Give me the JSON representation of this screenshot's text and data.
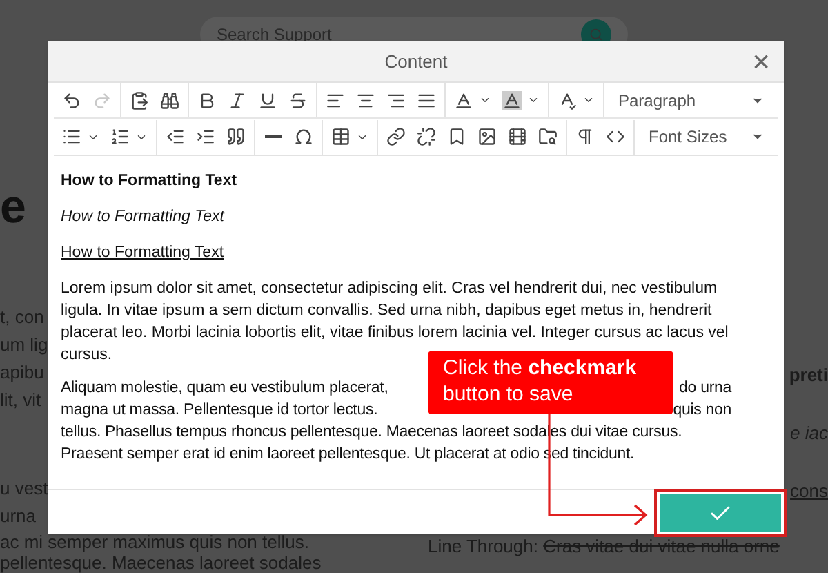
{
  "background": {
    "search": {
      "placeholder": "Search Support"
    },
    "left_fragments": [
      "e",
      "t, con",
      "um lig",
      "apibu",
      "lit, vit",
      "u vest",
      "urna"
    ],
    "right_fragments": [
      "preti",
      "e iac",
      "cons"
    ],
    "bottom_left": [
      "ac mi semper maximus quis non tellus.",
      "pellentesque. Maecenas laoreet sodales"
    ],
    "bottom_right": [
      {
        "label": "Line Through:",
        "struck": "Cras vitae dui vitae nulla orne"
      }
    ]
  },
  "dialog": {
    "title": "Content",
    "close": "×",
    "toolbar": [
      [
        [
          {
            "kind": "button",
            "disabled": false
          },
          {
            "kind": "button",
            "disabled": true
          }
        ],
        [
          {
            "kind": "button",
            "disabled": false
          },
          {
            "kind": "button",
            "disabled": false
          }
        ],
        [
          {
            "kind": "button",
            "disabled": false
          },
          {
            "kind": "button",
            "disabled": false
          },
          {
            "kind": "button",
            "disabled": false
          },
          {
            "kind": "button",
            "disabled": false
          }
        ],
        [
          {
            "kind": "button",
            "disabled": false
          },
          {
            "kind": "button",
            "disabled": false
          },
          {
            "kind": "button",
            "disabled": false
          },
          {
            "kind": "button",
            "disabled": false
          }
        ],
        [
          {
            "kind": "split",
            "disabled": false
          },
          {
            "kind": "split",
            "disabled": false
          }
        ],
        [
          {
            "kind": "split",
            "disabled": false
          }
        ],
        [
          {
            "kind": "select",
            "value": "Paragraph"
          }
        ]
      ],
      [
        [
          {
            "kind": "split",
            "disabled": false
          },
          {
            "kind": "split",
            "disabled": false
          }
        ],
        [
          {
            "kind": "button",
            "disabled": false
          },
          {
            "kind": "button",
            "disabled": false
          },
          {
            "kind": "button",
            "disabled": false
          }
        ],
        [
          {
            "kind": "button",
            "disabled": false
          },
          {
            "kind": "button",
            "disabled": false
          }
        ],
        [
          {
            "kind": "split",
            "disabled": false
          }
        ],
        [
          {
            "kind": "button",
            "disabled": false
          },
          {
            "kind": "button",
            "disabled": false
          },
          {
            "kind": "button",
            "disabled": false
          },
          {
            "kind": "button",
            "disabled": false
          },
          {
            "kind": "button",
            "disabled": false
          },
          {
            "kind": "button",
            "disabled": false
          }
        ],
        [
          {
            "kind": "button",
            "disabled": false
          },
          {
            "kind": "button",
            "disabled": false
          }
        ],
        [
          {
            "kind": "select",
            "value": "Font Sizes"
          }
        ]
      ]
    ],
    "content": [
      {
        "kind": "bold",
        "text": "How to Formatting Text"
      },
      {
        "kind": "italic",
        "text": "How to Formatting Text"
      },
      {
        "kind": "underline",
        "text": "How to Formatting Text"
      },
      {
        "kind": "paragraph",
        "text": "Lorem ipsum dolor sit amet, consectetur adipiscing elit. Cras vel hendrerit dui, nec vestibulum ligula. In vitae ipsum a sem dictum convallis. Sed urna nibh, dapibus eget metus in, hendrerit placerat leo. Morbi lacinia lobortis elit, vitae finibus lorem lacinia vel. Integer cursus ac lacus vel cursus."
      },
      {
        "kind": "lines",
        "lines": [
          {
            "left": "Aliquam molestie, quam eu vestibulum placerat,",
            "right": "do urna"
          },
          {
            "left": "magna ut massa. Pellentesque id tortor lectus.",
            "right": "quis non"
          },
          {
            "left": "tellus. Phasellus tempus rhoncus pellentesque. Maecenas laoreet sodales dui vitae cursus."
          },
          {
            "left": "Praesent semper erat id enim laoreet pellentesque. Ut placerat at odio sed tincidunt."
          }
        ]
      }
    ]
  },
  "callout": {
    "text": "Click the **checkmark** button to save"
  }
}
